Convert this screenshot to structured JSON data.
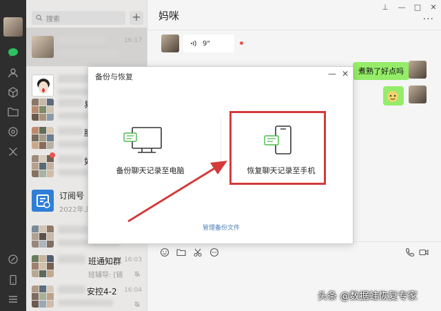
{
  "search": {
    "placeholder": "搜索"
  },
  "list_header": {
    "add_label": "+"
  },
  "rows": [
    {
      "name": "",
      "msg": "",
      "time": "16:17"
    },
    {
      "name": "",
      "msg": "",
      "time": ""
    },
    {
      "name": "易",
      "msg": "",
      "time": ""
    },
    {
      "name": "股",
      "msg": "",
      "time": ""
    },
    {
      "name": "如",
      "msg": "",
      "time": ""
    },
    {
      "name": "订阅号",
      "msg": "2022年上",
      "time": ""
    },
    {
      "name": "",
      "msg": "",
      "time": ""
    },
    {
      "name": "班通知群",
      "msg": "班辅导: [链",
      "time": "16:03"
    },
    {
      "name": "安控4-2",
      "msg": "",
      "time": "16:04"
    }
  ],
  "chat": {
    "title": "妈咪",
    "voice_duration": "9\"",
    "outgoing_text": "煮熟了好点吗",
    "more_label": "···"
  },
  "window": {
    "pin": "⊥",
    "min": "—",
    "max": "□",
    "close": "✕"
  },
  "modal": {
    "title": "备份与恢复",
    "backup_label": "备份聊天记录至电脑",
    "restore_label": "恢复聊天记录至手机",
    "manage_link": "管理备份文件",
    "close": "✕",
    "min": "—"
  },
  "colors": {
    "accent_green": "#95ec69",
    "highlight_red": "#d43a3a",
    "link_blue": "#4a7fb5",
    "nav_bg": "#2e2e2e"
  },
  "watermark": "头条 @数据蛙恢复专家"
}
